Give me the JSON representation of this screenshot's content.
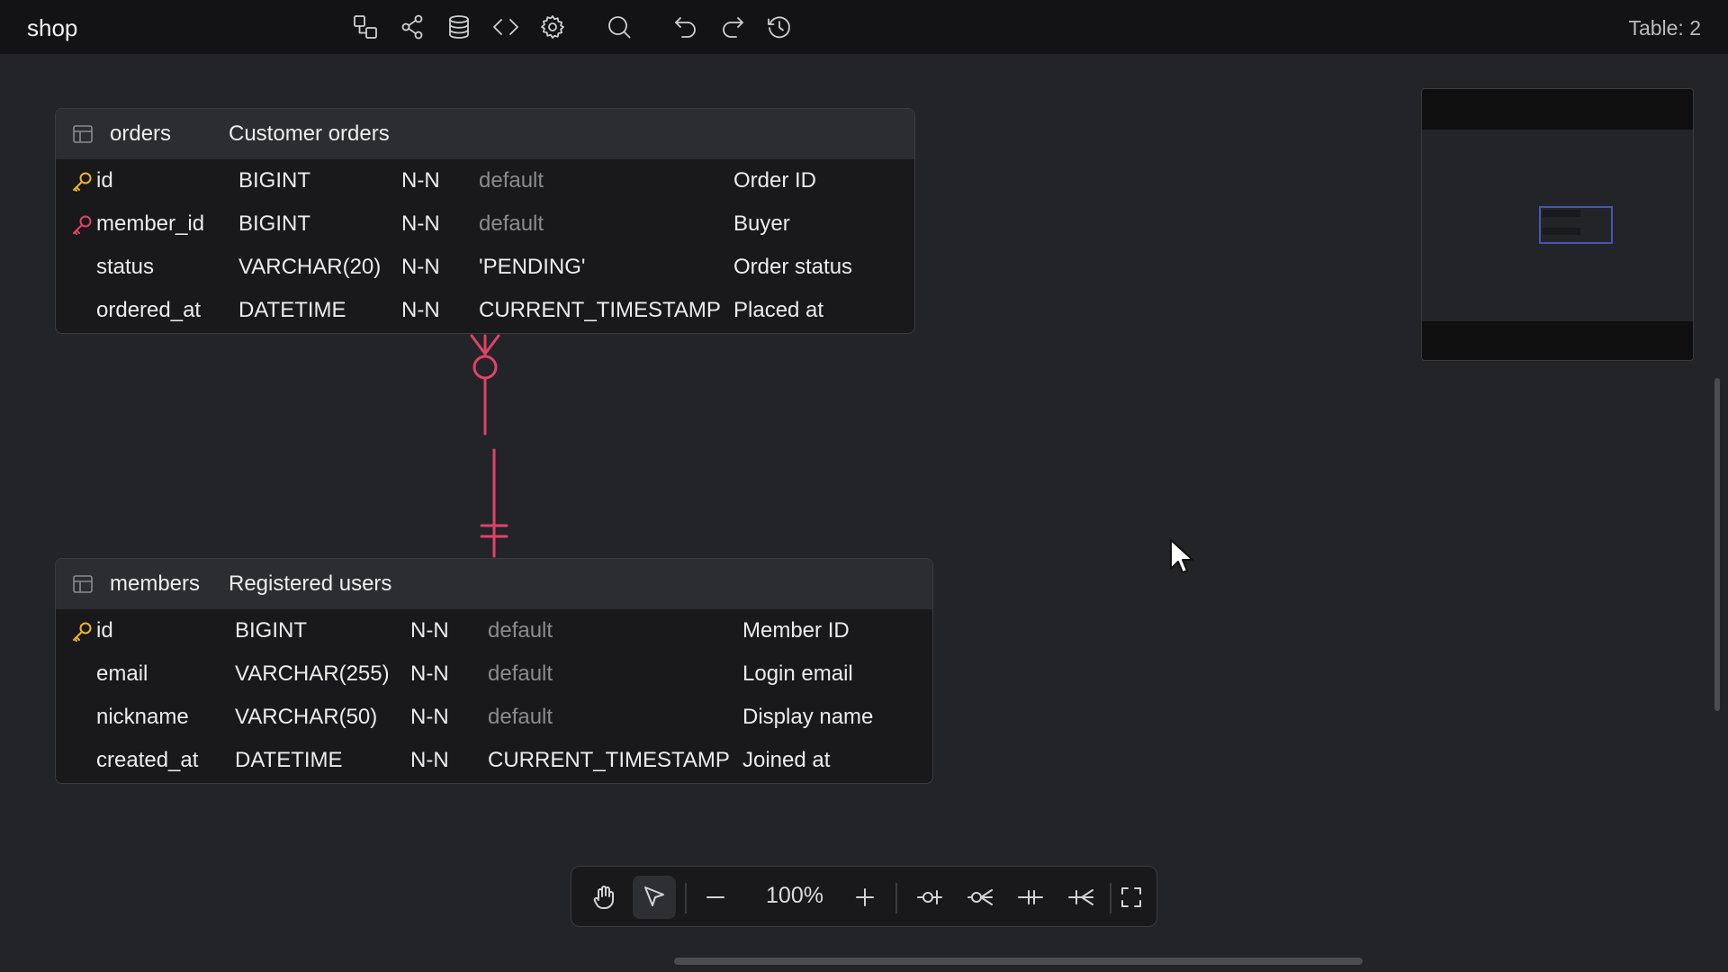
{
  "app": {
    "name": "shop",
    "table_count": "Table: 2"
  },
  "toolbar": {
    "icons": [
      "diagram-icon",
      "share-icon",
      "database-icon",
      "code-icon",
      "settings-icon",
      "search-icon",
      "undo-icon",
      "redo-icon",
      "history-icon"
    ]
  },
  "tables": {
    "orders": {
      "name": "orders",
      "comment": "Customer orders",
      "rows": [
        {
          "key": "primary",
          "name": "id",
          "type": "BIGINT",
          "nn": "N-N",
          "default": "default",
          "default_muted": true,
          "comment": "Order ID"
        },
        {
          "key": "foreign",
          "name": "member_id",
          "type": "BIGINT",
          "nn": "N-N",
          "default": "default",
          "default_muted": true,
          "comment": "Buyer"
        },
        {
          "key": "",
          "name": "status",
          "type": "VARCHAR(20)",
          "nn": "N-N",
          "default": "'PENDING'",
          "default_muted": false,
          "comment": "Order status"
        },
        {
          "key": "",
          "name": "ordered_at",
          "type": "DATETIME",
          "nn": "N-N",
          "default": "CURRENT_TIMESTAMP",
          "default_muted": false,
          "comment": "Placed at"
        }
      ]
    },
    "members": {
      "name": "members",
      "comment": "Registered users",
      "rows": [
        {
          "key": "primary",
          "name": "id",
          "type": "BIGINT",
          "nn": "N-N",
          "default": "default",
          "default_muted": true,
          "comment": "Member ID"
        },
        {
          "key": "",
          "name": "email",
          "type": "VARCHAR(255)",
          "nn": "N-N",
          "default": "default",
          "default_muted": true,
          "comment": "Login email"
        },
        {
          "key": "",
          "name": "nickname",
          "type": "VARCHAR(50)",
          "nn": "N-N",
          "default": "default",
          "default_muted": true,
          "comment": "Display name"
        },
        {
          "key": "",
          "name": "created_at",
          "type": "DATETIME",
          "nn": "N-N",
          "default": "CURRENT_TIMESTAMP",
          "default_muted": false,
          "comment": "Joined at"
        }
      ]
    }
  },
  "relationship": {
    "from": "orders.member_id",
    "to": "members.id",
    "color": "#e0426a"
  },
  "bottom_toolbar": {
    "zoom": "100%",
    "active_tool": "select"
  },
  "colors": {
    "primary_key": "#f0b429",
    "foreign_key": "#e0426a",
    "accent": "#4656b4"
  }
}
